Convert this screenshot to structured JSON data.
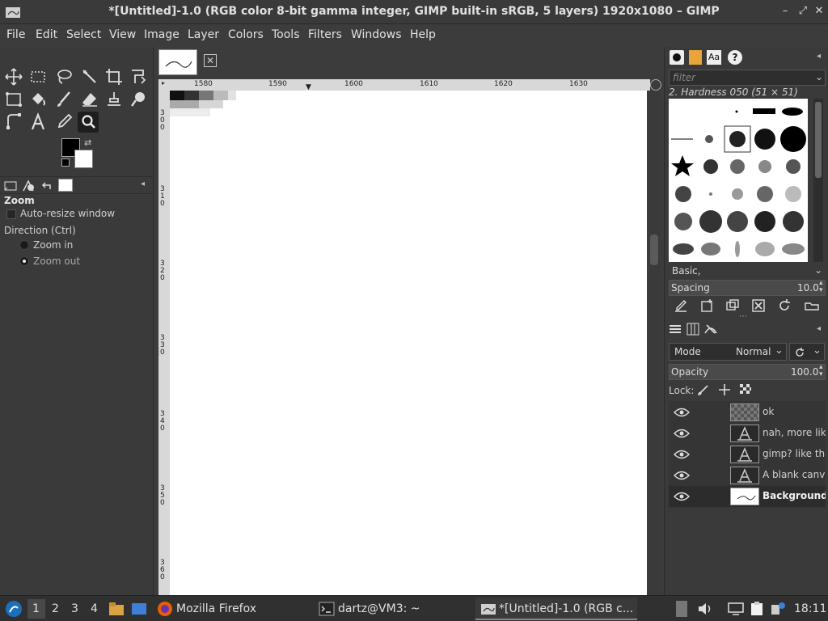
{
  "window": {
    "title": "*[Untitled]-1.0 (RGB color 8-bit gamma integer, GIMP built-in sRGB, 5 layers) 1920x1080 – GIMP",
    "controls": [
      "–",
      "⤢",
      "✕"
    ]
  },
  "menu": [
    "File",
    "Edit",
    "Select",
    "View",
    "Image",
    "Layer",
    "Colors",
    "Tools",
    "Filters",
    "Windows",
    "Help"
  ],
  "tool_options": {
    "title": "Zoom",
    "auto_resize": "Auto-resize window",
    "direction_label": "Direction  (Ctrl)",
    "zoom_in": "Zoom in",
    "zoom_out": "Zoom out",
    "selected_direction": "Zoom out"
  },
  "ruler": {
    "h_ticks": [
      "1580",
      "1590",
      "1600",
      "1610",
      "1620",
      "1630"
    ],
    "v_ticks": [
      "3\n0\n0",
      "3\n1\n0",
      "3\n2\n0",
      "3\n3\n0",
      "3\n4\n0",
      "3\n5\n0",
      "3\n6\n0"
    ]
  },
  "brushes": {
    "filter_placeholder": "filter",
    "selected": "2. Hardness 050 (51 × 51)",
    "tag": "Basic,",
    "spacing_label": "Spacing",
    "spacing_value": "10.0"
  },
  "layers": {
    "mode_label": "Mode",
    "mode_value": "Normal",
    "opacity_label": "Opacity",
    "opacity_value": "100.0",
    "lock_label": "Lock:",
    "items": [
      {
        "name": "ok",
        "bold": false
      },
      {
        "name": "nah, more like",
        "bold": false
      },
      {
        "name": "gimp? like the",
        "bold": false
      },
      {
        "name": "A blank canva",
        "bold": false
      },
      {
        "name": "Background",
        "bold": true
      }
    ]
  },
  "taskbar": {
    "workspaces": [
      "1",
      "2",
      "3",
      "4"
    ],
    "tasks": [
      "Mozilla Firefox",
      "dartz@VM3: ~",
      "*[Untitled]-1.0 (RGB c..."
    ],
    "clock": "18:11"
  }
}
